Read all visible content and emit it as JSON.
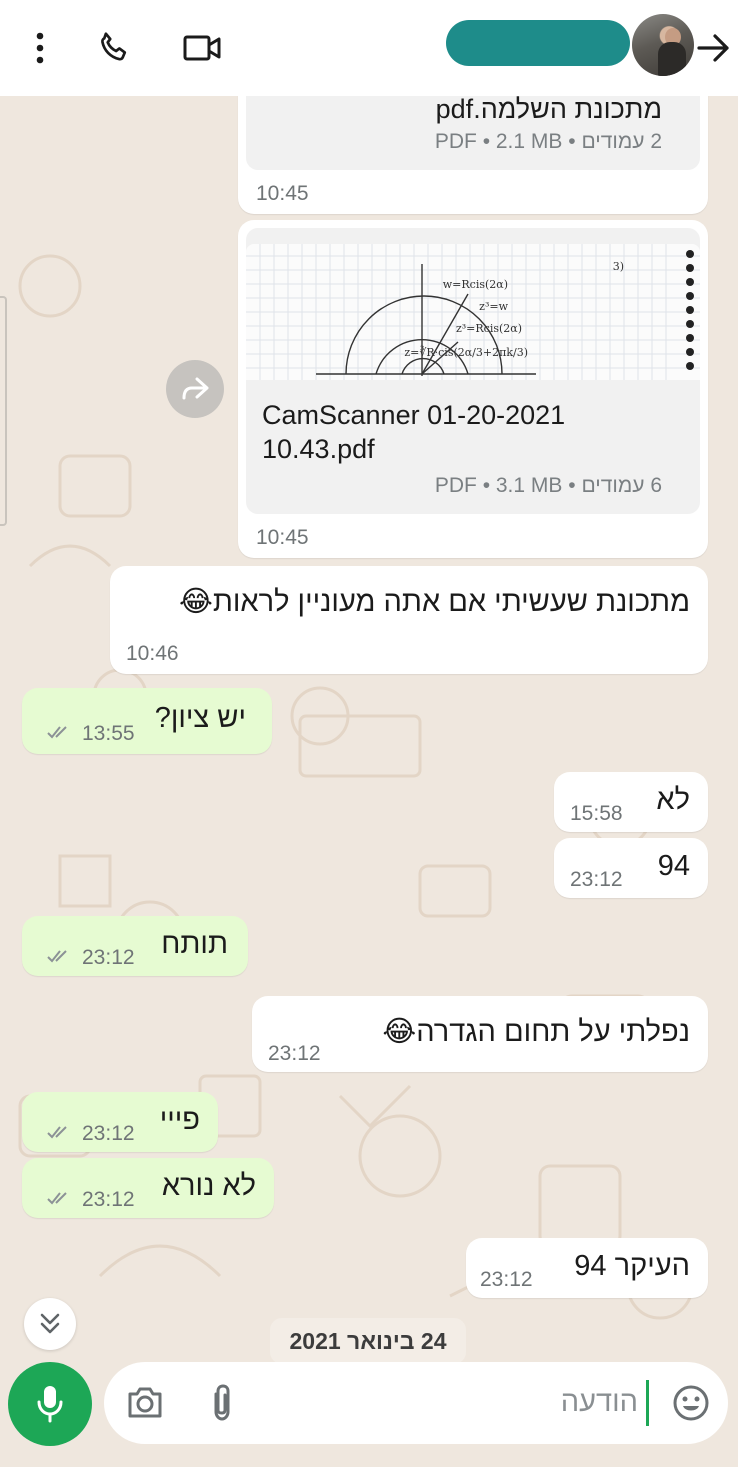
{
  "header": {
    "back_icon": "arrow-right-icon",
    "avatar_alt": "contact-avatar",
    "actions": [
      "more-vertical-icon",
      "phone-icon",
      "video-icon"
    ]
  },
  "messages": {
    "doc1": {
      "name": "מתכונת השלמה.pdf",
      "meta": "2 עמודים • PDF • 2.1 MB",
      "time": "10:45"
    },
    "doc2": {
      "name_line1": "CamScanner 01-20-2021",
      "name_line2": "10.43.pdf",
      "meta": "6 עמודים • PDF • 3.1 MB",
      "time": "10:45"
    },
    "m1": {
      "text": "מתכונת שעשיתי אם אתה מעוניין לראות😂",
      "time": "10:46"
    },
    "m2": {
      "text": "יש ציון?",
      "time": "13:55"
    },
    "m3": {
      "text": "לא",
      "time": "15:58"
    },
    "m4": {
      "text": "94",
      "time": "23:12"
    },
    "m5": {
      "text": "תותח",
      "time": "23:12"
    },
    "m6": {
      "text": "נפלתי על תחום הגדרה😂",
      "time": "23:12"
    },
    "m7": {
      "text": "פייי",
      "time": "23:12"
    },
    "m8": {
      "text": "לא נורא",
      "time": "23:12"
    },
    "m9": {
      "text": "העיקר 94",
      "time": "23:12"
    }
  },
  "date_chip": "24 בינואר 2021",
  "composer": {
    "placeholder": "הודעה",
    "icons": [
      "emoji-icon",
      "attach-icon",
      "camera-icon",
      "mic-icon"
    ]
  },
  "colors": {
    "incoming": "#ffffff",
    "outgoing": "#e6fbd2",
    "accent": "#1da756",
    "read_ticks": "#8c9296"
  }
}
